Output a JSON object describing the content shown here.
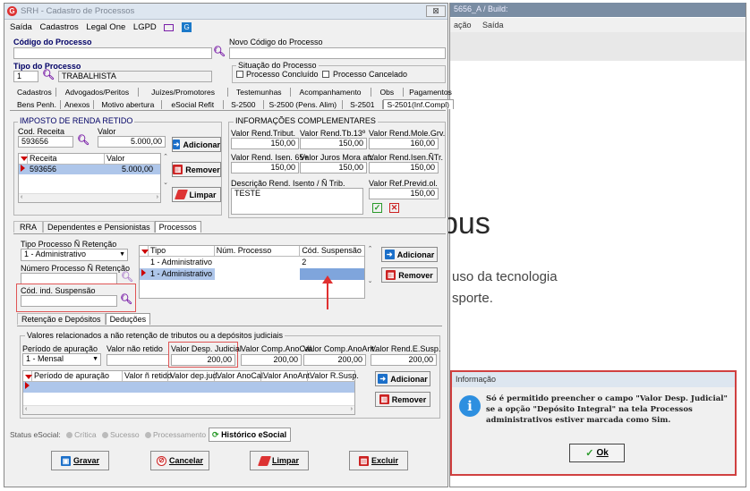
{
  "background_app": {
    "title": "5656_A / Build:",
    "menu": [
      "ação",
      "Saída"
    ],
    "big_text": "bus",
    "line1": "uso da tecnologia",
    "line2": "sporte."
  },
  "window": {
    "title": "SRH - Cadastro de Processos",
    "close_label": "⊠",
    "menu": [
      "Saída",
      "Cadastros",
      "Legal One",
      "LGPD"
    ]
  },
  "header": {
    "codigo_label": "Código do Processo",
    "codigo_value": "",
    "novo_codigo_label": "Novo Código do Processo",
    "novo_codigo_value": "",
    "tipo_label": "Tipo do Processo",
    "tipo_code": "1",
    "tipo_desc": "TRABALHISTA",
    "situacao_title": "Situação do Processo",
    "concluido_label": "Processo Concluído",
    "cancelado_label": "Processo Cancelado"
  },
  "tabs_row1": [
    "Cadastros",
    "Advogados/Peritos",
    "Juízes/Promotores",
    "Testemunhas",
    "Acompanhamento",
    "Obs",
    "Pagamentos"
  ],
  "tabs_row2": [
    "Bens Penh.",
    "Anexos",
    "Motivo abertura",
    "eSocial Refit",
    "S-2500",
    "S-2500 (Pens. Alim)",
    "S-2501",
    "S-2501(Inf.Compl)"
  ],
  "irrf": {
    "title": "IMPOSTO DE RENDA RETIDO",
    "cod_receita_label": "Cod. Receita",
    "cod_receita_value": "593656",
    "valor_label": "Valor",
    "valor_value": "5.000,00",
    "col_receita": "Receita",
    "col_valor": "Valor",
    "row_receita": "593656",
    "row_valor": "5.000,00",
    "btn_adicionar": "Adicionar",
    "btn_remover": "Remover",
    "btn_limpar": "Limpar"
  },
  "info": {
    "title": "INFORMAÇÕES COMPLEMENTARES",
    "f1_label": "Valor Rend.Tribut.",
    "f1_value": "150,00",
    "f2_label": "Valor Rend.Tb.13º",
    "f2_value": "150,00",
    "f3_label": "Valor Rend.Mole.Grv.",
    "f3_value": "160,00",
    "f4_label": "Valor Rend. Isen. 65+",
    "f4_value": "150,00",
    "f5_label": "Valor Juros Mora atr.",
    "f5_value": "150,00",
    "f6_label": "Valor Rend.Isen.ÑTr.",
    "f6_value": "150,00",
    "desc_label": "Descrição Rend. Isento / Ñ Trib.",
    "desc_value": "TESTE",
    "ref_label": "Valor Ref.Previd.ol.",
    "ref_value": "150,00"
  },
  "subtabs": [
    "RRA",
    "Dependentes e Pensionistas",
    "Processos"
  ],
  "processos": {
    "tipo_label": "Tipo Processo Ñ Retenção",
    "tipo_value": "1 - Administrativo",
    "numero_label": "Número Processo Ñ Retenção",
    "cod_susp_label": "Cód. ind. Suspensão",
    "col_tipo": "Tipo",
    "col_num": "Núm. Processo",
    "col_cod": "Cód. Suspensão",
    "rows": [
      {
        "tipo": "1 - Administrativo",
        "num": "",
        "cod": "2"
      },
      {
        "tipo": "1 - Administrativo",
        "num": "",
        "cod": ""
      }
    ],
    "btn_adicionar": "Adicionar",
    "btn_remover": "Remover"
  },
  "subtabs2": [
    "Retenção e Depósitos",
    "Deduções"
  ],
  "valores": {
    "title": "Valores relacionados a não retenção de tributos ou a depósitos judiciais",
    "periodo_label": "Período de apuração",
    "periodo_value": "1 - Mensal",
    "v1_label": "Valor não retido",
    "v1_value": "",
    "v2_label": "Valor Desp. Judicial",
    "v2_value": "200,00",
    "v3_label": "Valor Comp.AnoCal.",
    "v3_value": "200,00",
    "v4_label": "Valor Comp.AnoAnt.",
    "v4_value": "200,00",
    "v5_label": "Valor Rend.E.Susp.",
    "v5_value": "200,00",
    "cols": [
      "Período de apuração",
      "Valor ñ retido",
      "Valor dep.jud.",
      "Valor AnoCal.",
      "Valor AnoAnt.",
      "Valor R.Susp."
    ],
    "btn_adicionar": "Adicionar",
    "btn_remover": "Remover"
  },
  "status": {
    "label": "Status eSocial:",
    "critica": "Crítica",
    "sucesso": "Sucesso",
    "processamento": "Processamento",
    "historico": "Histórico eSocial"
  },
  "footer": {
    "gravar": "Gravar",
    "cancelar": "Cancelar",
    "limpar": "Limpar",
    "excluir": "Excluir"
  },
  "dialog": {
    "title": "Informação",
    "message": "Só é permitido preencher o campo \"Valor Desp. Judicial\" se a opção \"Depósito Integral\" na tela Processos administrativos estiver marcada como Sim.",
    "ok": "Ok"
  },
  "colors": {
    "accent_red": "#d04040",
    "title_blue": "#000066",
    "select_blue": "#aec6ea"
  }
}
